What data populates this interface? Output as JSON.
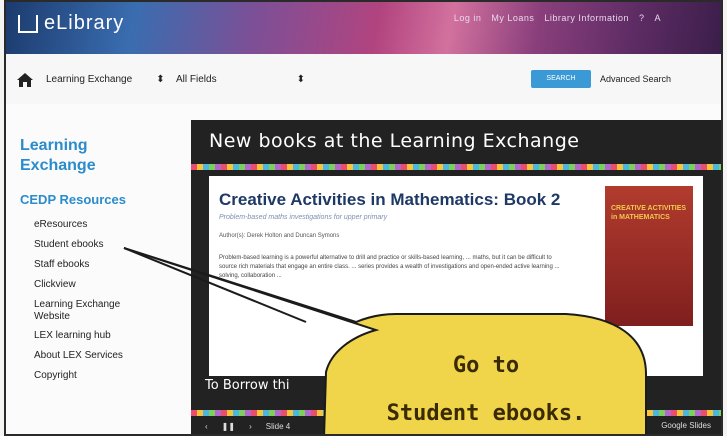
{
  "header": {
    "logo_text": "eLibrary",
    "links": [
      "Log in",
      "My Loans",
      "Library Information",
      "?",
      "A"
    ]
  },
  "search": {
    "scope": "Learning Exchange",
    "field": "All Fields",
    "search_button": "SEARCH",
    "advanced": "Advanced Search"
  },
  "sidebar": {
    "title": "Learning Exchange",
    "section": "CEDP Resources",
    "items": [
      {
        "label": "eResources"
      },
      {
        "label": "Student ebooks"
      },
      {
        "label": "Staff ebooks"
      },
      {
        "label": "Clickview"
      },
      {
        "label": "Learning Exchange Website"
      },
      {
        "label": "LEX learning hub"
      },
      {
        "label": "About LEX Services"
      },
      {
        "label": "Copyright"
      }
    ]
  },
  "carousel": {
    "heading": "New books at the Learning Exchange",
    "book_title": "Creative Activities in Mathematics: Book 2",
    "book_subtitle": "Problem-based maths investigations for upper primary",
    "authors": "Author(s): Derek Holton and Duncan Symons",
    "body": "Problem-based learning is a powerful alternative to drill and practice or skills-based learning, ... maths, but it can be difficult to source rich materials that engage an entire class. ... series provides a wealth of investigations and open-ended active learning ... solving, collaboration ...",
    "cover_text": "CREATIVE ACTIVITIES in MATHEMATICS",
    "borrow": "To Borrow thi",
    "slide_label": "Slide 4",
    "google_slides": "Google Slides"
  },
  "callout": {
    "line1": "Go to",
    "line2": "Student ebooks."
  }
}
